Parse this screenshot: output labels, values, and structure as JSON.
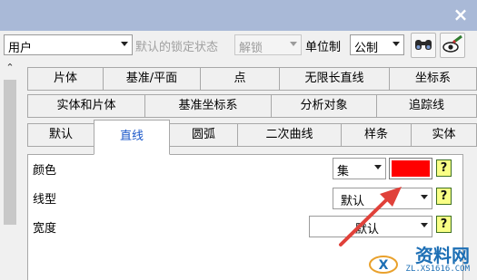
{
  "titlebar": {
    "close_icon": "close-icon"
  },
  "toolbar": {
    "user_select": "用户",
    "lock_label": "默认的锁定状态",
    "lock_select": "解锁",
    "unit_label": "单位制",
    "unit_select": "公制"
  },
  "tabs": {
    "row1": [
      "片体",
      "基准/平面",
      "点",
      "无限长直线",
      "坐标系"
    ],
    "row2": [
      "实体和片体",
      "基准坐标系",
      "分析对象",
      "追踪线"
    ],
    "row3": [
      "默认",
      "直线",
      "圆弧",
      "二次曲线",
      "样条",
      "实体"
    ],
    "active": "直线"
  },
  "content": {
    "color_label": "颜色",
    "color_select": "集",
    "color_value": "#ff0000",
    "linetype_label": "线型",
    "linetype_select": "默认",
    "width_label": "宽度",
    "width_select": "默认",
    "help_glyph": "?"
  },
  "watermark": {
    "title": "资料网",
    "url": "ZL.XS1616.COM"
  }
}
